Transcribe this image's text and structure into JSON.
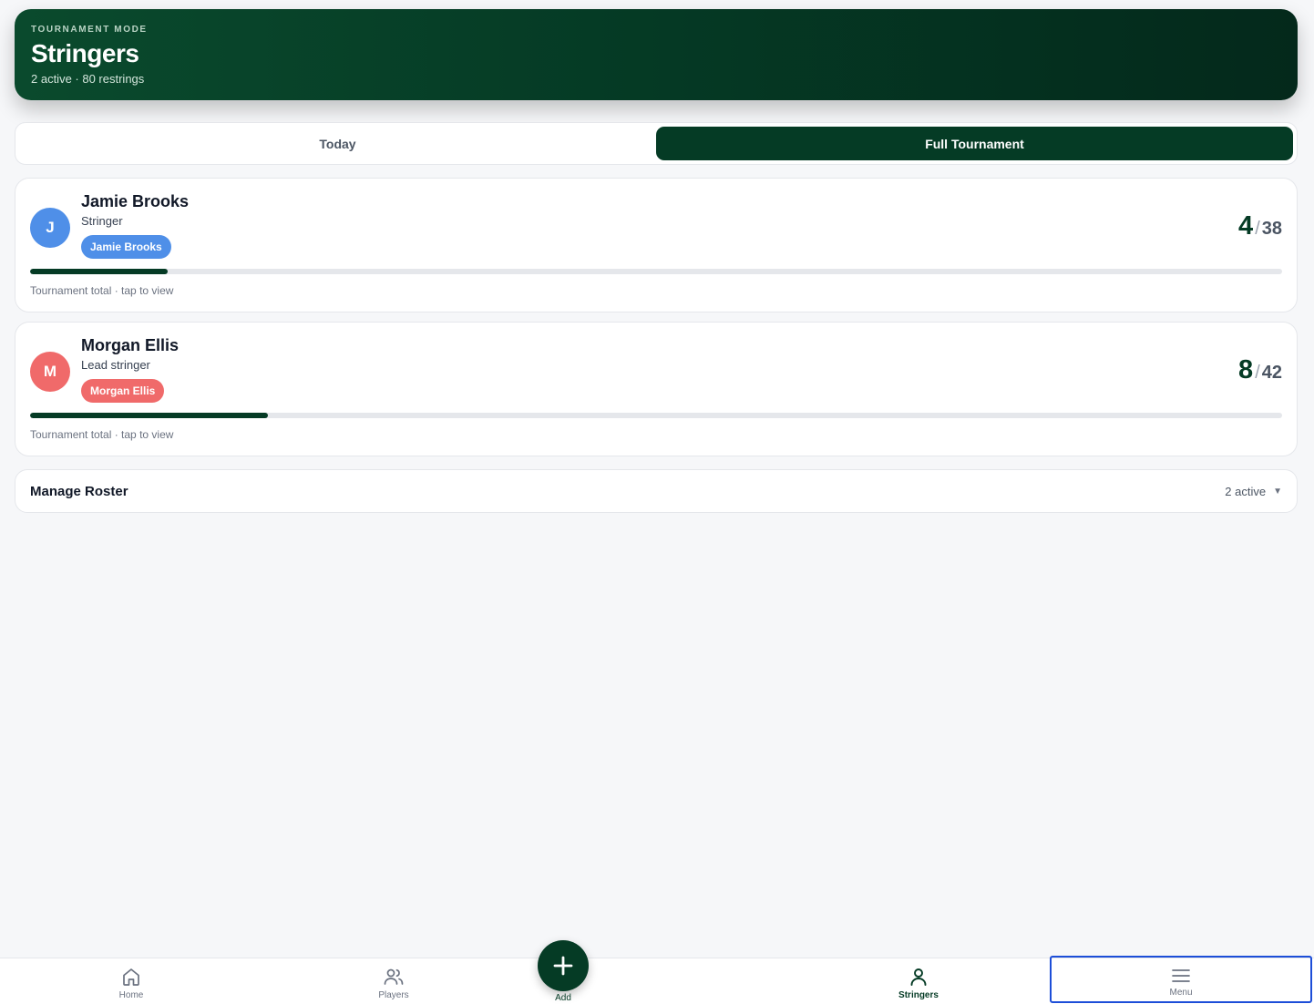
{
  "header": {
    "eyebrow": "TOURNAMENT MODE",
    "title": "Stringers",
    "subtitle": "2 active · 80 restrings"
  },
  "tabs": [
    {
      "label": "Today",
      "active": false
    },
    {
      "label": "Full Tournament",
      "active": true
    }
  ],
  "stringers": [
    {
      "initial": "J",
      "name": "Jamie Brooks",
      "role": "Stringer",
      "chip": "Jamie Brooks",
      "color": "#4f8fe8",
      "count": "4",
      "slash": "/",
      "total": "38",
      "progress_fraction": 0.11,
      "hint": "Tournament total · tap to view"
    },
    {
      "initial": "M",
      "name": "Morgan Ellis",
      "role": "Lead stringer",
      "chip": "Morgan Ellis",
      "color": "#f06a6a",
      "count": "8",
      "slash": "/",
      "total": "42",
      "progress_fraction": 0.19,
      "hint": "Tournament total · tap to view"
    }
  ],
  "roster": {
    "label": "Manage Roster",
    "status": "2 active",
    "caret": "▼"
  },
  "nav": {
    "home": "Home",
    "players": "Players",
    "add": "Add",
    "stringers": "Stringers",
    "menu": "Menu"
  },
  "colors": {
    "brand": "#053b25",
    "accent_focus": "#1d4ed8"
  }
}
